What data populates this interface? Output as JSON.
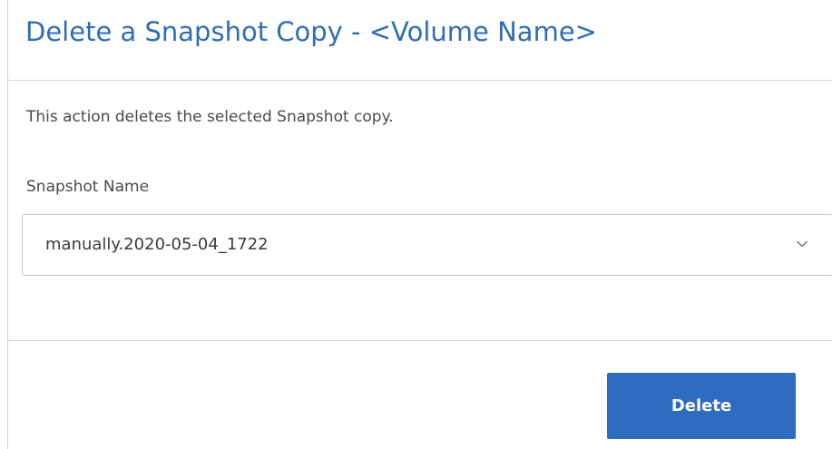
{
  "dialog": {
    "title": "Delete a Snapshot Copy - <Volume Name>",
    "description": "This action deletes the selected Snapshot copy.",
    "snapshot_field": {
      "label": "Snapshot Name",
      "selected_value": "manually.2020-05-04_1722",
      "icon": "chevron-down-icon"
    },
    "delete_label": "Delete"
  },
  "colors": {
    "title": "#2f6db5",
    "button_background": "#2e6cc0",
    "button_text": "#ffffff",
    "body_text": "#4a4a4a"
  }
}
